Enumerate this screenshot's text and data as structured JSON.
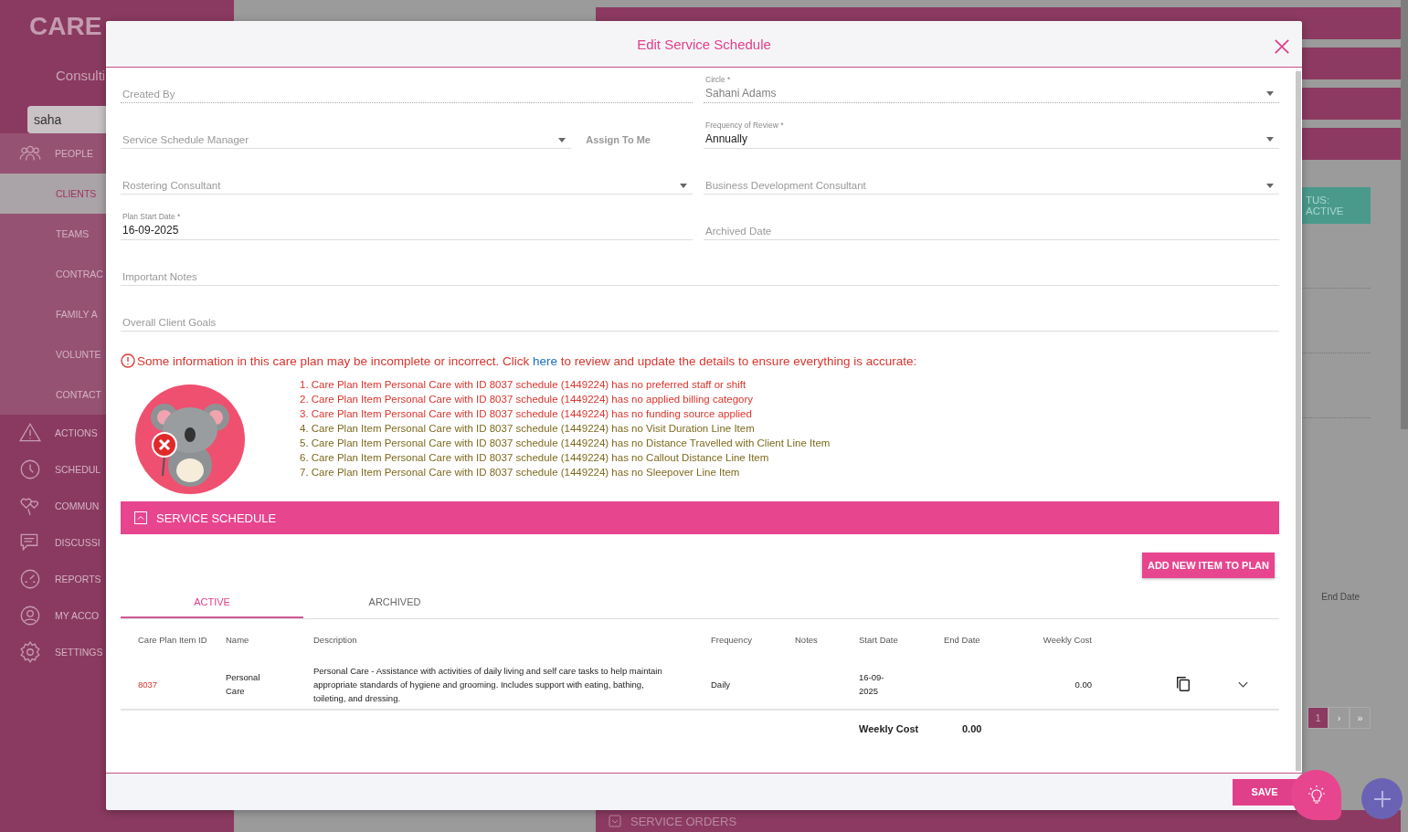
{
  "sidebar": {
    "logo": "CARE",
    "subtitle": "Consulti",
    "search": "saha",
    "items": [
      {
        "label": "PEOPLE",
        "expanded": true,
        "children": [
          {
            "label": "CLIENTS",
            "selected": true
          },
          {
            "label": "TEAMS",
            "selected": false
          },
          {
            "label": "CONTRAC",
            "selected": false
          },
          {
            "label": "FAMILY A",
            "selected": false
          },
          {
            "label": "VOLUNTE",
            "selected": false
          },
          {
            "label": "CONTACT",
            "selected": false
          }
        ]
      },
      {
        "label": "ACTIONS"
      },
      {
        "label": "SCHEDUL"
      },
      {
        "label": "COMMUN"
      },
      {
        "label": "DISCUSSI"
      },
      {
        "label": "REPORTS"
      },
      {
        "label": "MY ACCO"
      },
      {
        "label": "SETTINGS"
      }
    ]
  },
  "background": {
    "status": "TUS: ACTIVE",
    "column": "End Date",
    "pages": [
      {
        "label": "1",
        "selected": true
      },
      {
        "label": "›",
        "selected": false
      },
      {
        "label": "»",
        "selected": false
      }
    ],
    "bottom_section": "SERVICE ORDERS"
  },
  "dialog": {
    "title": "Edit Service Schedule",
    "form": {
      "created_by": {
        "placeholder": "Created By",
        "disabled": true
      },
      "circle": {
        "label": "Circle *",
        "value": "Sahani Adams",
        "disabled": true
      },
      "manager": {
        "placeholder": "Service Schedule Manager",
        "disabled": false
      },
      "assign_to_me": "Assign To Me",
      "frequency": {
        "label": "Frequency of Review *",
        "value": "Annually",
        "disabled": false
      },
      "rostering": {
        "placeholder": "Rostering Consultant",
        "disabled": false
      },
      "bd_consultant": {
        "placeholder": "Business Development Consultant",
        "disabled": false
      },
      "plan_start": {
        "label": "Plan Start Date *",
        "value": "16-09-2025",
        "disabled": false
      },
      "archived_date": {
        "placeholder": "Archived Date",
        "disabled": false
      },
      "important_notes": {
        "placeholder": "Important Notes",
        "disabled": false
      },
      "goals": {
        "placeholder": "Overall Client Goals",
        "disabled": false
      }
    },
    "warning": {
      "before": "Some information in this care plan may be incomplete or incorrect. Click ",
      "link": "here",
      "after": " to review and update the details to ensure everything is accurate:",
      "issues": [
        {
          "text": "1. Care Plan Item Personal Care with ID 8037 schedule (1449224) has no preferred staff or shift",
          "color": "#d9352e"
        },
        {
          "text": "2. Care Plan Item Personal Care with ID 8037 schedule (1449224) has no applied billing category",
          "color": "#d9352e"
        },
        {
          "text": "3. Care Plan Item Personal Care with ID 8037 schedule (1449224) has no funding source applied",
          "color": "#d9352e"
        },
        {
          "text": "4. Care Plan Item Personal Care with ID 8037 schedule (1449224) has no Visit Duration Line Item",
          "color": "#7d6a1e"
        },
        {
          "text": "5. Care Plan Item Personal Care with ID 8037 schedule (1449224) has no Distance Travelled with Client Line Item",
          "color": "#7d6a1e"
        },
        {
          "text": "6. Care Plan Item Personal Care with ID 8037 schedule (1449224) has no Callout Distance Line Item",
          "color": "#7d6a1e"
        },
        {
          "text": "7. Care Plan Item Personal Care with ID 8037 schedule (1449224) has no Sleepover Line Item",
          "color": "#7d6a1e"
        }
      ]
    },
    "section": {
      "title": "SERVICE SCHEDULE",
      "expanded": true
    },
    "add_button": "ADD NEW ITEM TO PLAN",
    "tabs": [
      {
        "label": "ACTIVE",
        "selected": true
      },
      {
        "label": "ARCHIVED",
        "selected": false
      }
    ],
    "table": {
      "columns": [
        "Care Plan Item ID",
        "Name",
        "Description",
        "Frequency",
        "Notes",
        "Start Date",
        "End Date",
        "Weekly Cost"
      ],
      "rows": [
        {
          "cells": [
            "8037",
            "Personal Care",
            "Personal Care - Assistance with activities of daily living and self care tasks to help maintain appropriate standards of hygiene and grooming. Includes support with eating, bathing, toileting, and dressing.",
            "Daily",
            "",
            "16-09-2025",
            "",
            "0.00"
          ],
          "expanded": false
        }
      ],
      "total": {
        "label": "Weekly Cost",
        "value": "0.00"
      }
    },
    "save": "SAVE"
  }
}
